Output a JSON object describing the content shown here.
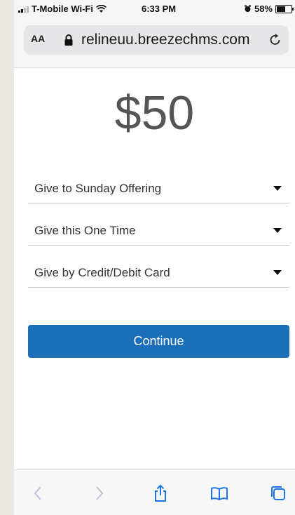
{
  "status_bar": {
    "carrier": "T-Mobile Wi-Fi",
    "time": "6:33 PM",
    "battery": "58%"
  },
  "address_bar": {
    "text_size_label": "AA",
    "url": "relineuu.breezechms.com"
  },
  "form": {
    "amount": "$50",
    "fund_select": "Give to Sunday Offering",
    "frequency_select": "Give this One Time",
    "payment_select": "Give by Credit/Debit Card",
    "continue_label": "Continue"
  },
  "colors": {
    "button": "#1a6fb8",
    "toolbar_icon": "#1a73e8",
    "disabled_icon": "#b8c4d6"
  },
  "toolbar_icons": [
    "back-icon",
    "forward-icon",
    "share-icon",
    "bookmarks-icon",
    "tabs-icon"
  ]
}
